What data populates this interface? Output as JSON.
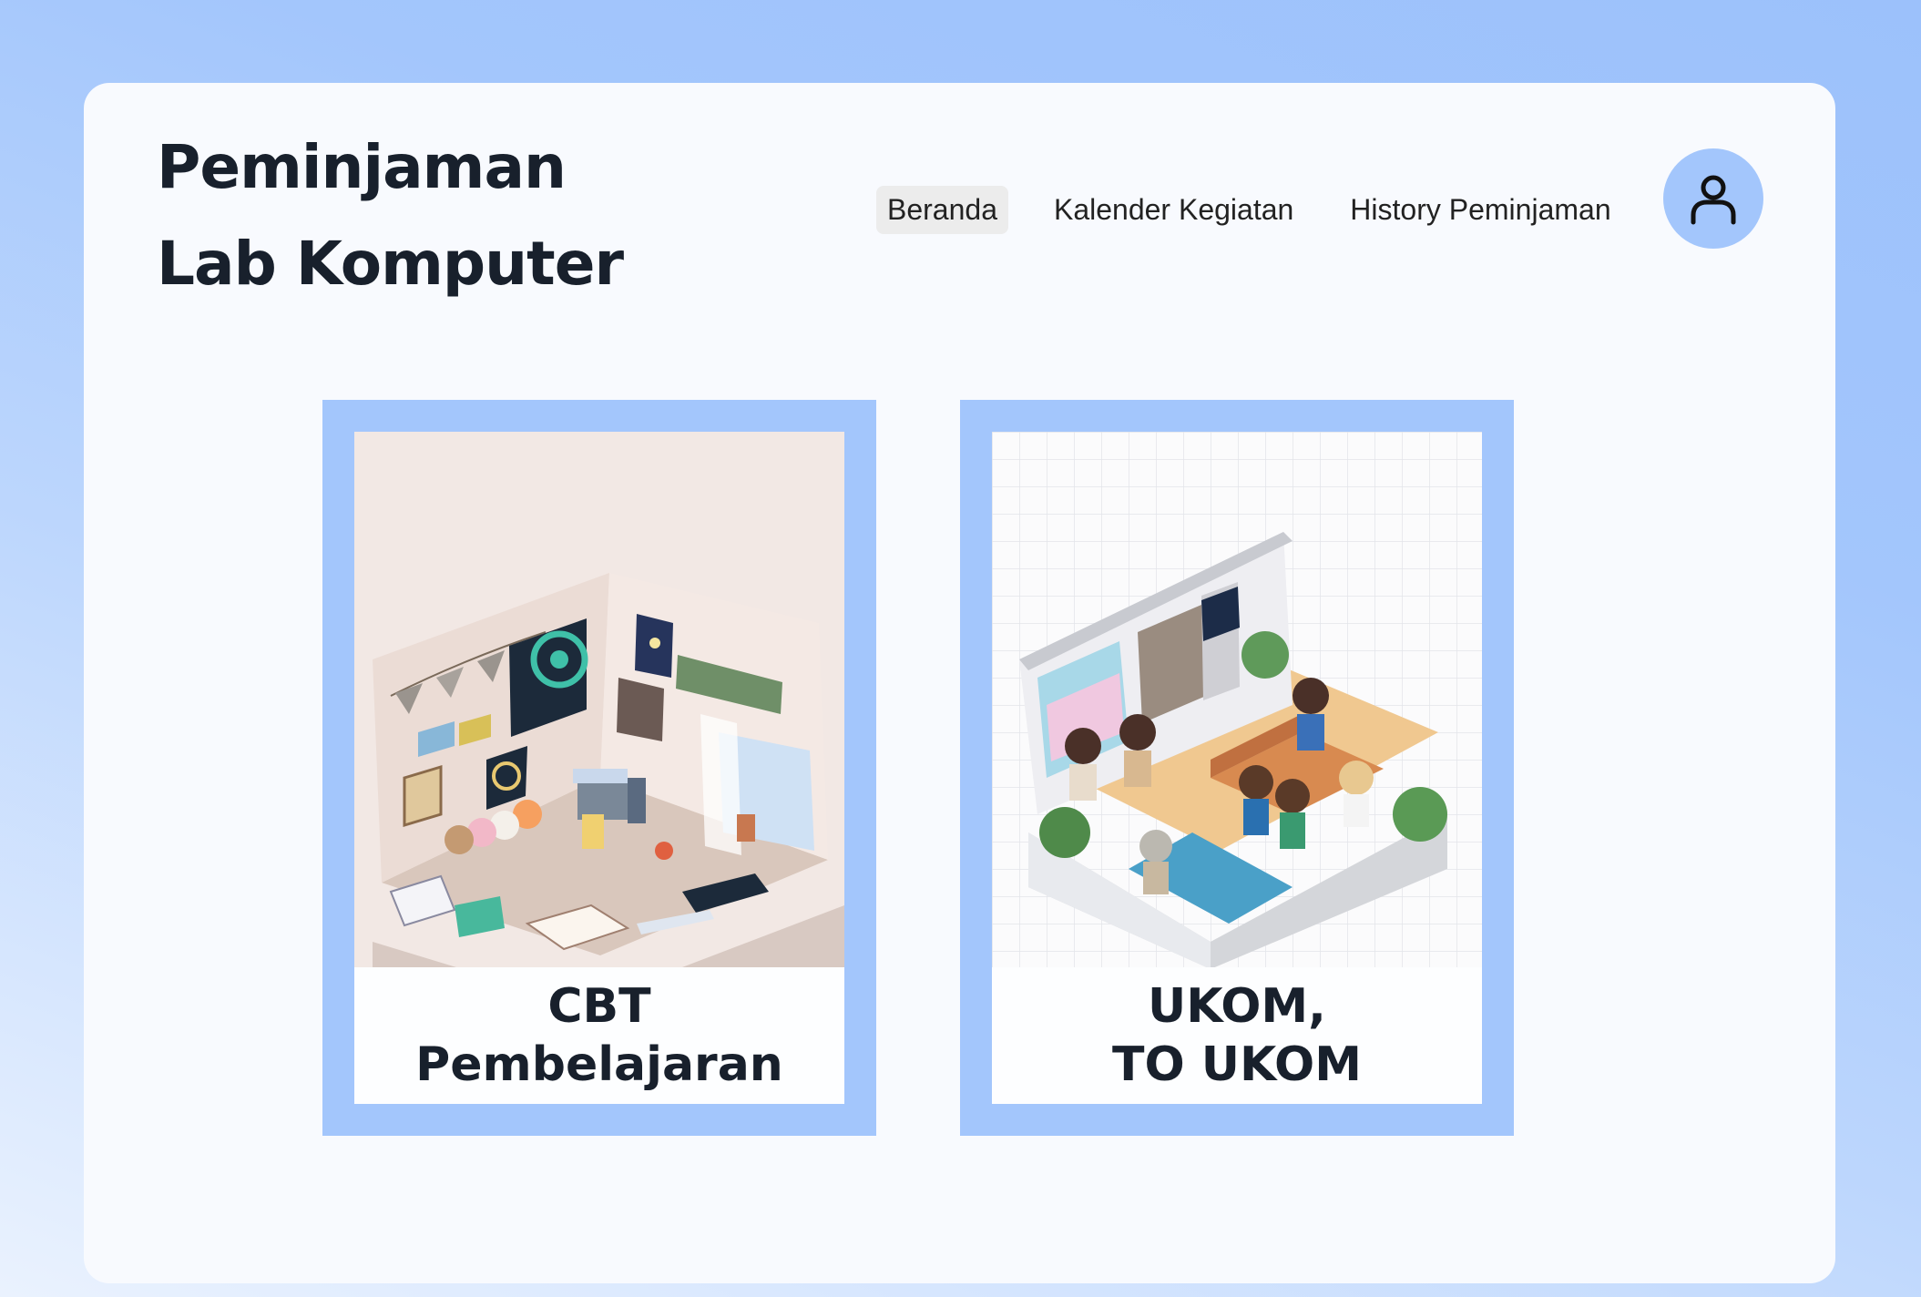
{
  "header": {
    "title_line1": "Peminjaman",
    "title_line2": "Lab Komputer"
  },
  "nav": {
    "items": [
      {
        "label": "Beranda",
        "active": true
      },
      {
        "label": "Kalender Kegiatan",
        "active": false
      },
      {
        "label": "History Peminjaman",
        "active": false
      }
    ]
  },
  "user": {
    "icon": "user-icon"
  },
  "cards": [
    {
      "line1": "CBT",
      "line2": "Pembelajaran",
      "image": "isometric-room-illustration"
    },
    {
      "line1": "UKOM,",
      "line2": "TO UKOM",
      "image": "pixel-art-house-illustration"
    }
  ],
  "colors": {
    "accent": "#a3c6fc",
    "text": "#18202c",
    "panel": "#f8fafe"
  }
}
